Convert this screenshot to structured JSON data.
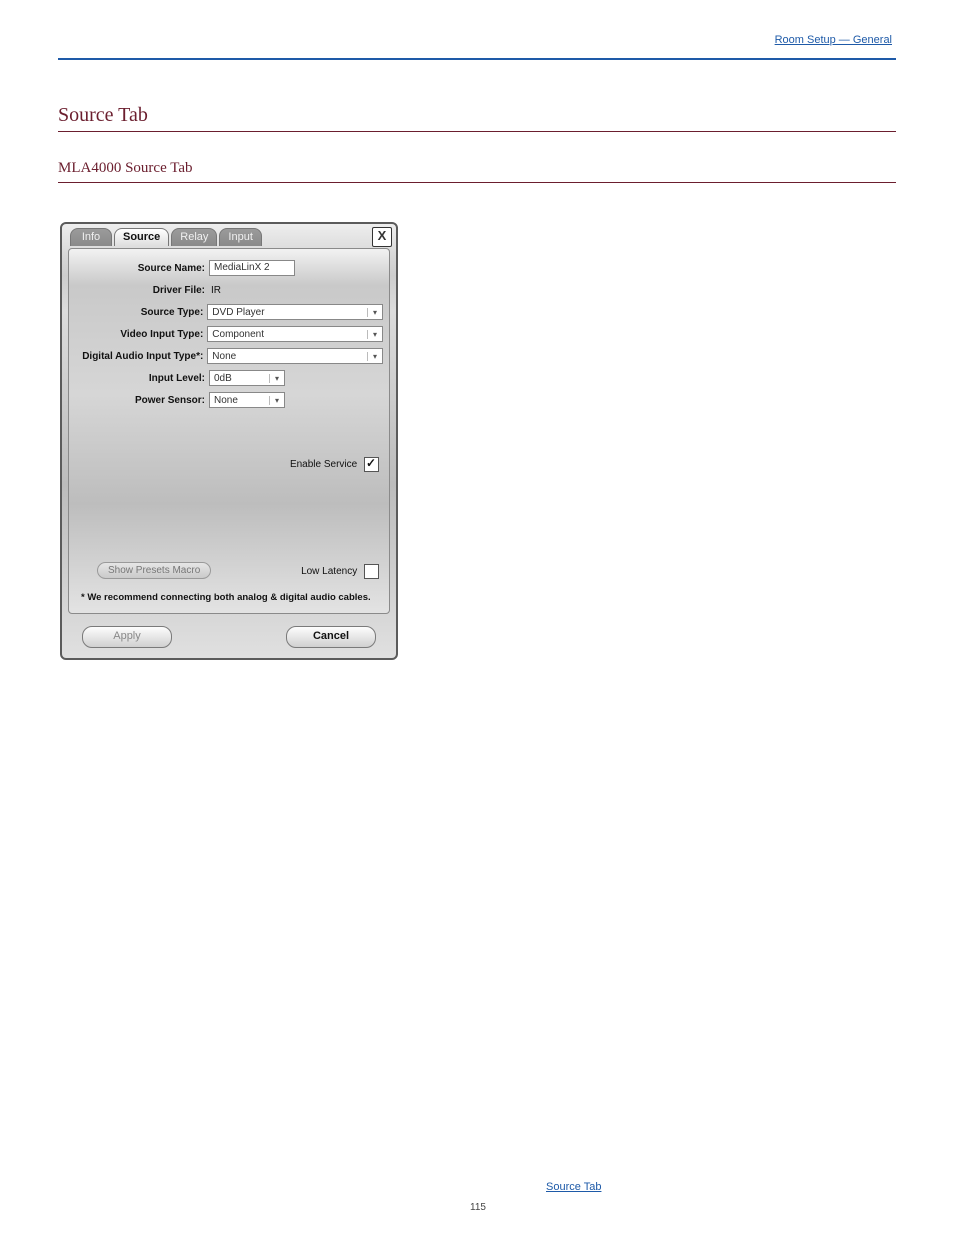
{
  "header": {
    "room_link": "Room Setup — General"
  },
  "section": {
    "heading": "Source Tab",
    "subheading": "MLA4000 Source Tab"
  },
  "panel": {
    "tabs": [
      "Info",
      "Source",
      "Relay",
      "Input"
    ],
    "active_tab": "Source",
    "close": "X",
    "fields": {
      "source_name_label": "Source Name:",
      "source_name_value": "MediaLinX 2",
      "driver_file_label": "Driver File:",
      "driver_file_value": "IR",
      "source_type_label": "Source Type:",
      "source_type_value": "DVD Player",
      "video_input_label": "Video Input Type:",
      "video_input_value": "Component",
      "digital_audio_label": "Digital Audio Input Type*:",
      "digital_audio_value": "None",
      "input_level_label": "Input Level:",
      "input_level_value": "0dB",
      "power_sensor_label": "Power Sensor:",
      "power_sensor_value": "None"
    },
    "enable_service_label": "Enable Service",
    "enable_service_checked": true,
    "show_presets_label": "Show Presets Macro",
    "low_latency_label": "Low Latency",
    "low_latency_checked": false,
    "footnote": "* We recommend connecting both analog & digital audio cables.",
    "apply_label": "Apply",
    "cancel_label": "Cancel"
  },
  "footer": {
    "source_tab_link": "Source Tab",
    "page_number": "115"
  }
}
